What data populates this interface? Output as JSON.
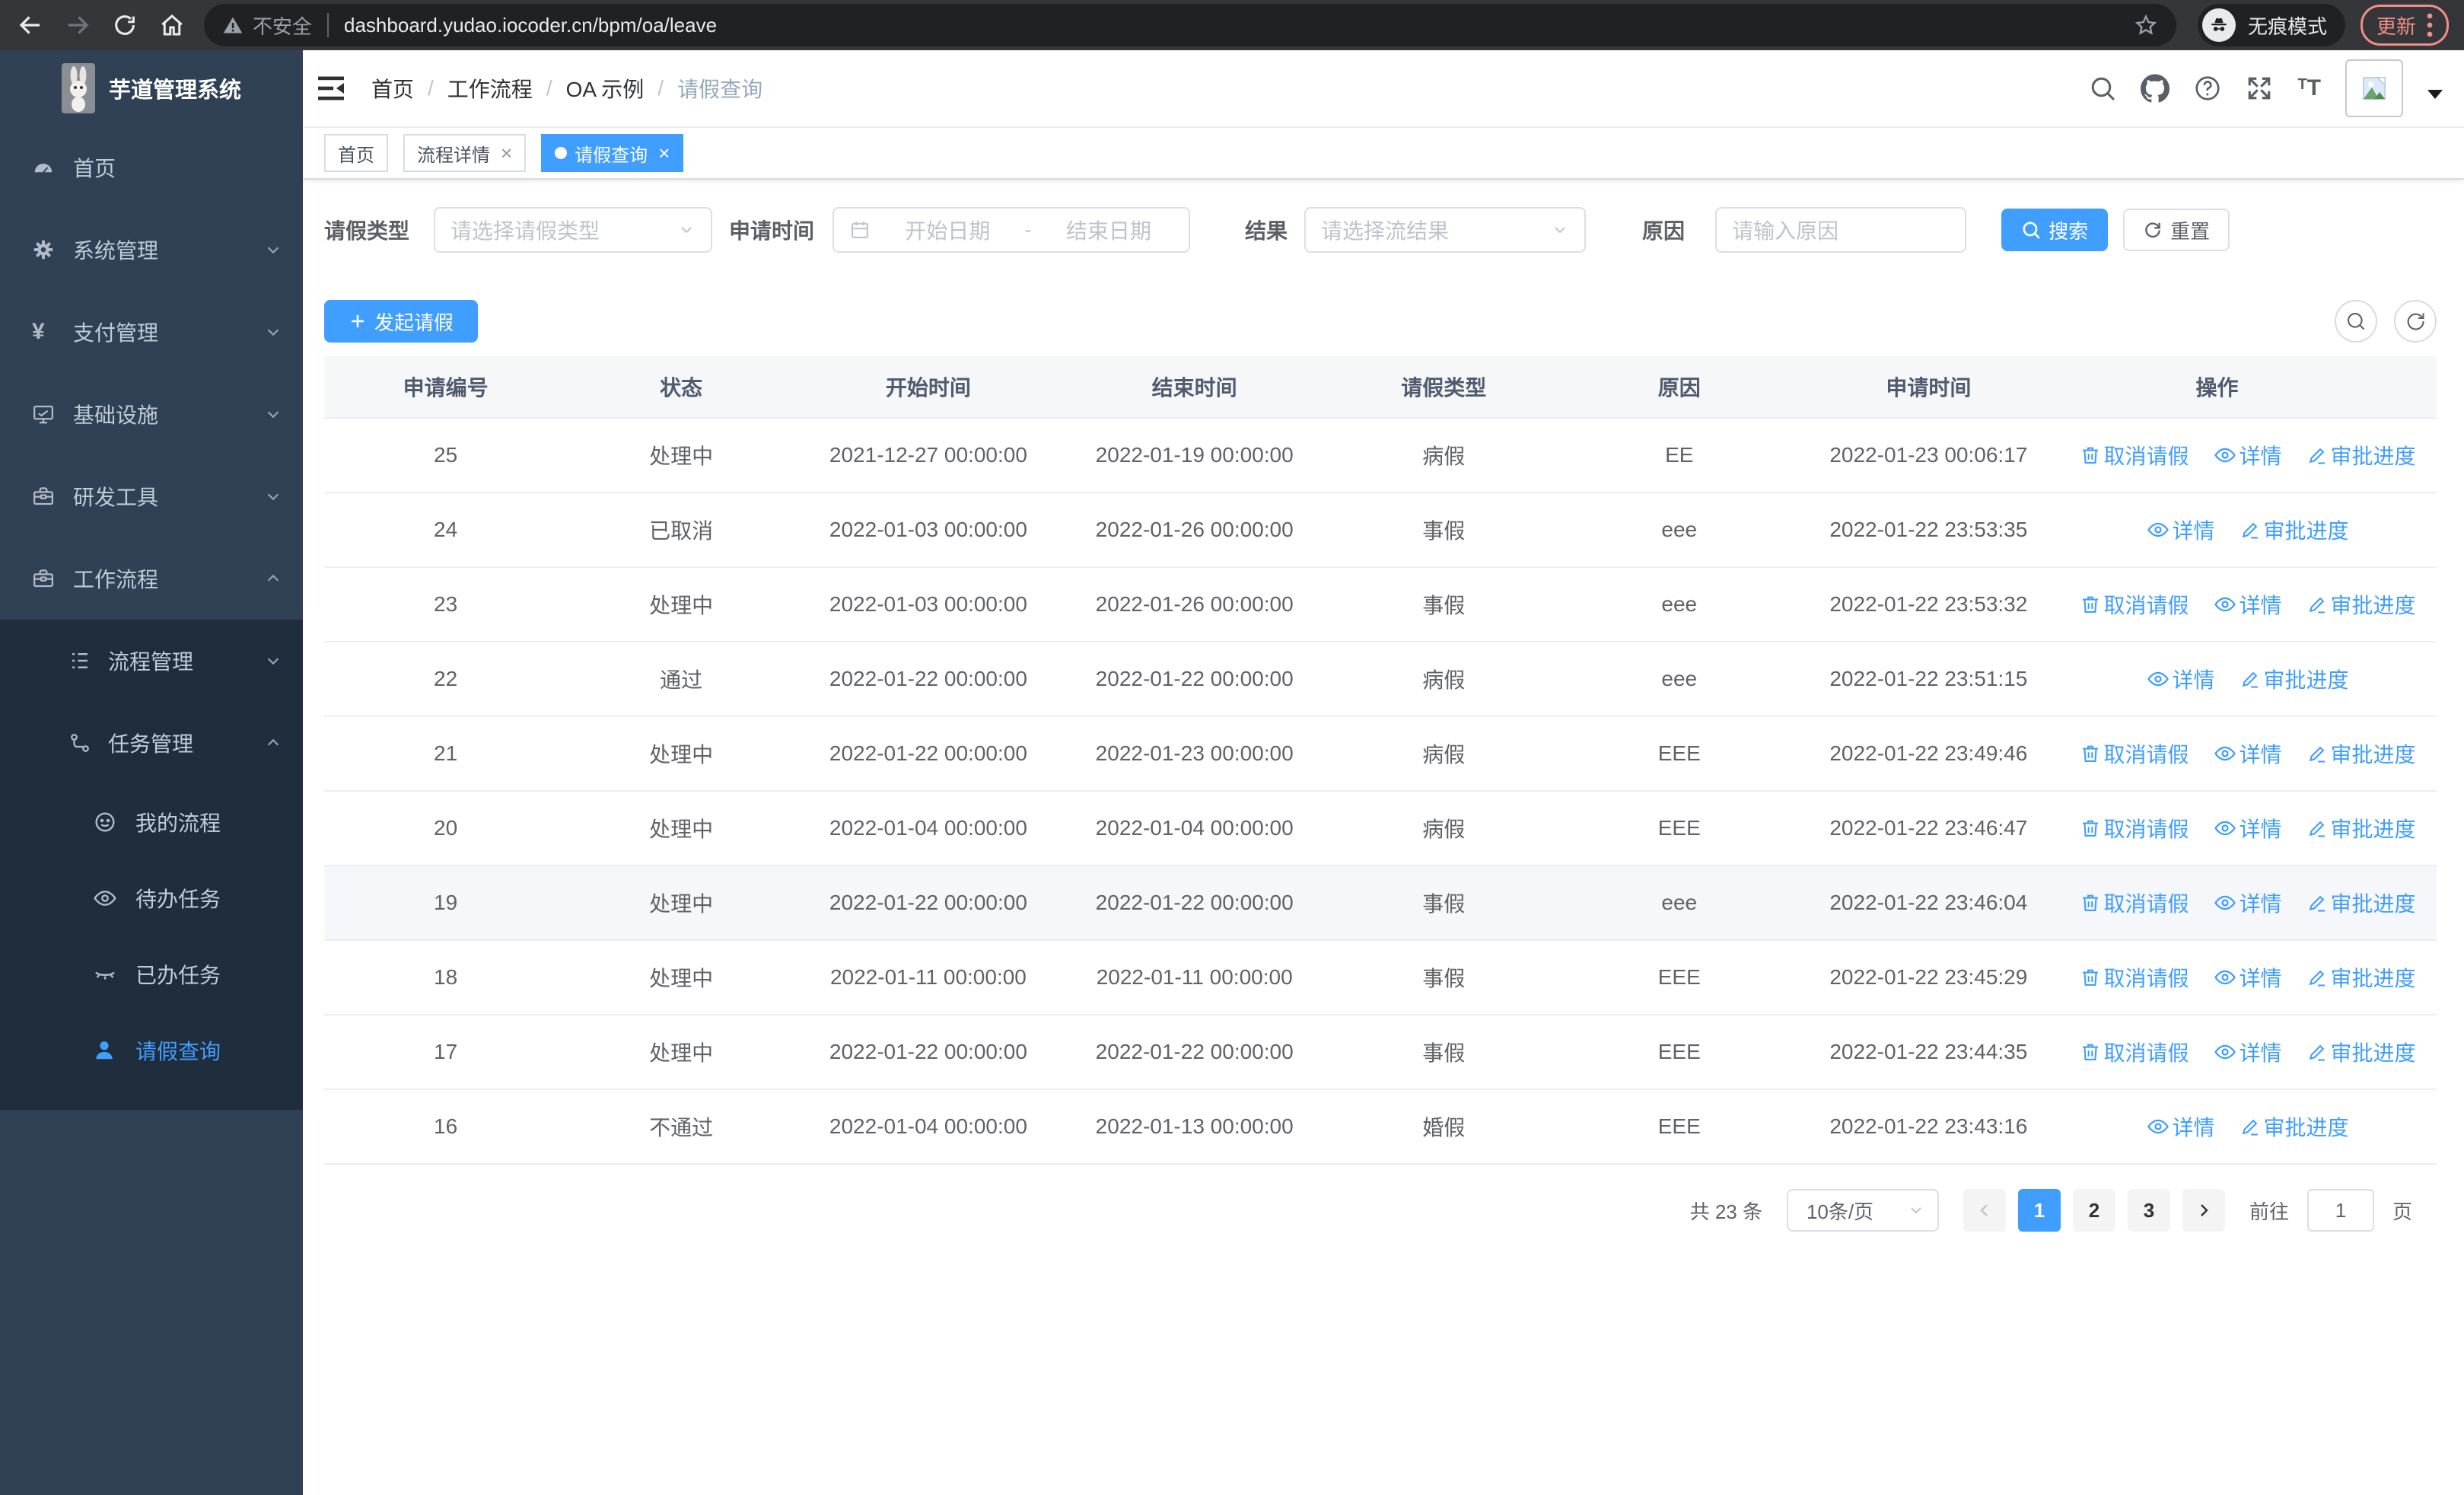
{
  "browser": {
    "url": "dashboard.yudao.iocoder.cn/bpm/oa/leave",
    "security_label": "不安全",
    "incognito_label": "无痕模式",
    "update_label": "更新"
  },
  "sidebar": {
    "title": "芋道管理系统",
    "menu": [
      {
        "label": "首页",
        "icon": "dashboard-icon",
        "level": 1
      },
      {
        "label": "系统管理",
        "icon": "gear-icon",
        "level": 1,
        "chevron": "down"
      },
      {
        "label": "支付管理",
        "icon": "yen-icon",
        "level": 1,
        "chevron": "down"
      },
      {
        "label": "基础设施",
        "icon": "monitor-icon",
        "level": 1,
        "chevron": "down"
      },
      {
        "label": "研发工具",
        "icon": "toolbox-icon",
        "level": 1,
        "chevron": "down"
      },
      {
        "label": "工作流程",
        "icon": "workflow-icon",
        "level": 1,
        "chevron": "up"
      },
      {
        "label": "流程管理",
        "icon": "tree-list-icon",
        "level": 2,
        "chevron": "down",
        "in_group": true
      },
      {
        "label": "任务管理",
        "icon": "flow-icon",
        "level": 2,
        "chevron": "up",
        "in_group": true
      },
      {
        "label": "我的流程",
        "icon": "face-icon",
        "level": 3,
        "in_group": true
      },
      {
        "label": "待办任务",
        "icon": "eye-icon",
        "level": 3,
        "in_group": true
      },
      {
        "label": "已办任务",
        "icon": "eye-closed-icon",
        "level": 3,
        "in_group": true
      },
      {
        "label": "请假查询",
        "icon": "user-icon",
        "level": 3,
        "in_group": true,
        "active": true
      }
    ]
  },
  "breadcrumb": [
    "首页",
    "工作流程",
    "OA 示例",
    "请假查询"
  ],
  "tabs": [
    {
      "label": "首页",
      "closable": false,
      "active": false
    },
    {
      "label": "流程详情",
      "closable": true,
      "active": false
    },
    {
      "label": "请假查询",
      "closable": true,
      "active": true
    }
  ],
  "filters": {
    "type_label": "请假类型",
    "type_placeholder": "请选择请假类型",
    "time_label": "申请时间",
    "start_placeholder": "开始日期",
    "range_separator": "-",
    "end_placeholder": "结束日期",
    "result_label": "结果",
    "result_placeholder": "请选择流结果",
    "reason_label": "原因",
    "reason_placeholder": "请输入原因",
    "search_label": "搜索",
    "reset_label": "重置"
  },
  "actions": {
    "create_label": "发起请假"
  },
  "ops_labels": {
    "cancel": "取消请假",
    "detail": "详情",
    "progress": "审批进度"
  },
  "table": {
    "columns": [
      "申请编号",
      "状态",
      "开始时间",
      "结束时间",
      "请假类型",
      "原因",
      "申请时间",
      "操作"
    ],
    "rows": [
      {
        "id": "25",
        "status": "处理中",
        "start": "2021-12-27 00:00:00",
        "end": "2022-01-19 00:00:00",
        "type": "病假",
        "reason": "EE",
        "applied": "2022-01-23 00:06:17",
        "ops": [
          "cancel",
          "detail",
          "progress"
        ],
        "highlight": false
      },
      {
        "id": "24",
        "status": "已取消",
        "start": "2022-01-03 00:00:00",
        "end": "2022-01-26 00:00:00",
        "type": "事假",
        "reason": "eee",
        "applied": "2022-01-22 23:53:35",
        "ops": [
          "detail",
          "progress"
        ],
        "highlight": false
      },
      {
        "id": "23",
        "status": "处理中",
        "start": "2022-01-03 00:00:00",
        "end": "2022-01-26 00:00:00",
        "type": "事假",
        "reason": "eee",
        "applied": "2022-01-22 23:53:32",
        "ops": [
          "cancel",
          "detail",
          "progress"
        ],
        "highlight": false
      },
      {
        "id": "22",
        "status": "通过",
        "start": "2022-01-22 00:00:00",
        "end": "2022-01-22 00:00:00",
        "type": "病假",
        "reason": "eee",
        "applied": "2022-01-22 23:51:15",
        "ops": [
          "detail",
          "progress"
        ],
        "highlight": false
      },
      {
        "id": "21",
        "status": "处理中",
        "start": "2022-01-22 00:00:00",
        "end": "2022-01-23 00:00:00",
        "type": "病假",
        "reason": "EEE",
        "applied": "2022-01-22 23:49:46",
        "ops": [
          "cancel",
          "detail",
          "progress"
        ],
        "highlight": false
      },
      {
        "id": "20",
        "status": "处理中",
        "start": "2022-01-04 00:00:00",
        "end": "2022-01-04 00:00:00",
        "type": "病假",
        "reason": "EEE",
        "applied": "2022-01-22 23:46:47",
        "ops": [
          "cancel",
          "detail",
          "progress"
        ],
        "highlight": false
      },
      {
        "id": "19",
        "status": "处理中",
        "start": "2022-01-22 00:00:00",
        "end": "2022-01-22 00:00:00",
        "type": "事假",
        "reason": "eee",
        "applied": "2022-01-22 23:46:04",
        "ops": [
          "cancel",
          "detail",
          "progress"
        ],
        "highlight": true
      },
      {
        "id": "18",
        "status": "处理中",
        "start": "2022-01-11 00:00:00",
        "end": "2022-01-11 00:00:00",
        "type": "事假",
        "reason": "EEE",
        "applied": "2022-01-22 23:45:29",
        "ops": [
          "cancel",
          "detail",
          "progress"
        ],
        "highlight": false
      },
      {
        "id": "17",
        "status": "处理中",
        "start": "2022-01-22 00:00:00",
        "end": "2022-01-22 00:00:00",
        "type": "事假",
        "reason": "EEE",
        "applied": "2022-01-22 23:44:35",
        "ops": [
          "cancel",
          "detail",
          "progress"
        ],
        "highlight": false
      },
      {
        "id": "16",
        "status": "不通过",
        "start": "2022-01-04 00:00:00",
        "end": "2022-01-13 00:00:00",
        "type": "婚假",
        "reason": "EEE",
        "applied": "2022-01-22 23:43:16",
        "ops": [
          "detail",
          "progress"
        ],
        "highlight": false
      }
    ]
  },
  "pagination": {
    "total_label": "共 23 条",
    "per_page": "10条/页",
    "pages": [
      "1",
      "2",
      "3"
    ],
    "current": "1",
    "goto_label": "前往",
    "goto_value": "1",
    "page_label": "页"
  }
}
